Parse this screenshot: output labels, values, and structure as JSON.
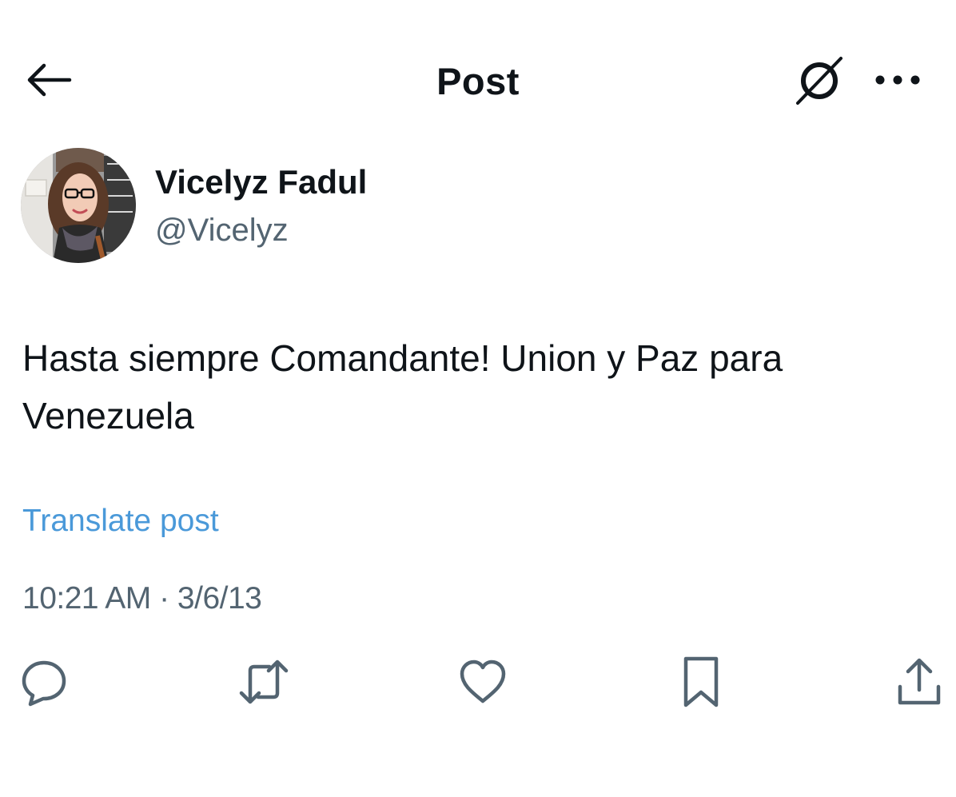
{
  "header": {
    "title": "Post",
    "back_icon": "arrow-left-icon",
    "grok_icon": "grok-slash-circle-icon",
    "more_icon": "more-horizontal-icon"
  },
  "author": {
    "display_name": "Vicelyz Fadul",
    "handle": "@Vicelyz"
  },
  "post": {
    "text": "Hasta siempre Comandante! Union y Paz para Venezuela",
    "translate_label": "Translate post",
    "timestamp": "10:21 AM · 3/6/13"
  },
  "actions": [
    {
      "icon": "reply-icon"
    },
    {
      "icon": "repost-icon"
    },
    {
      "icon": "like-icon"
    },
    {
      "icon": "bookmark-icon"
    },
    {
      "icon": "share-icon"
    }
  ],
  "colors": {
    "text_primary": "#0f1419",
    "text_secondary": "#536471",
    "link": "#4a99d9",
    "background": "#ffffff"
  }
}
